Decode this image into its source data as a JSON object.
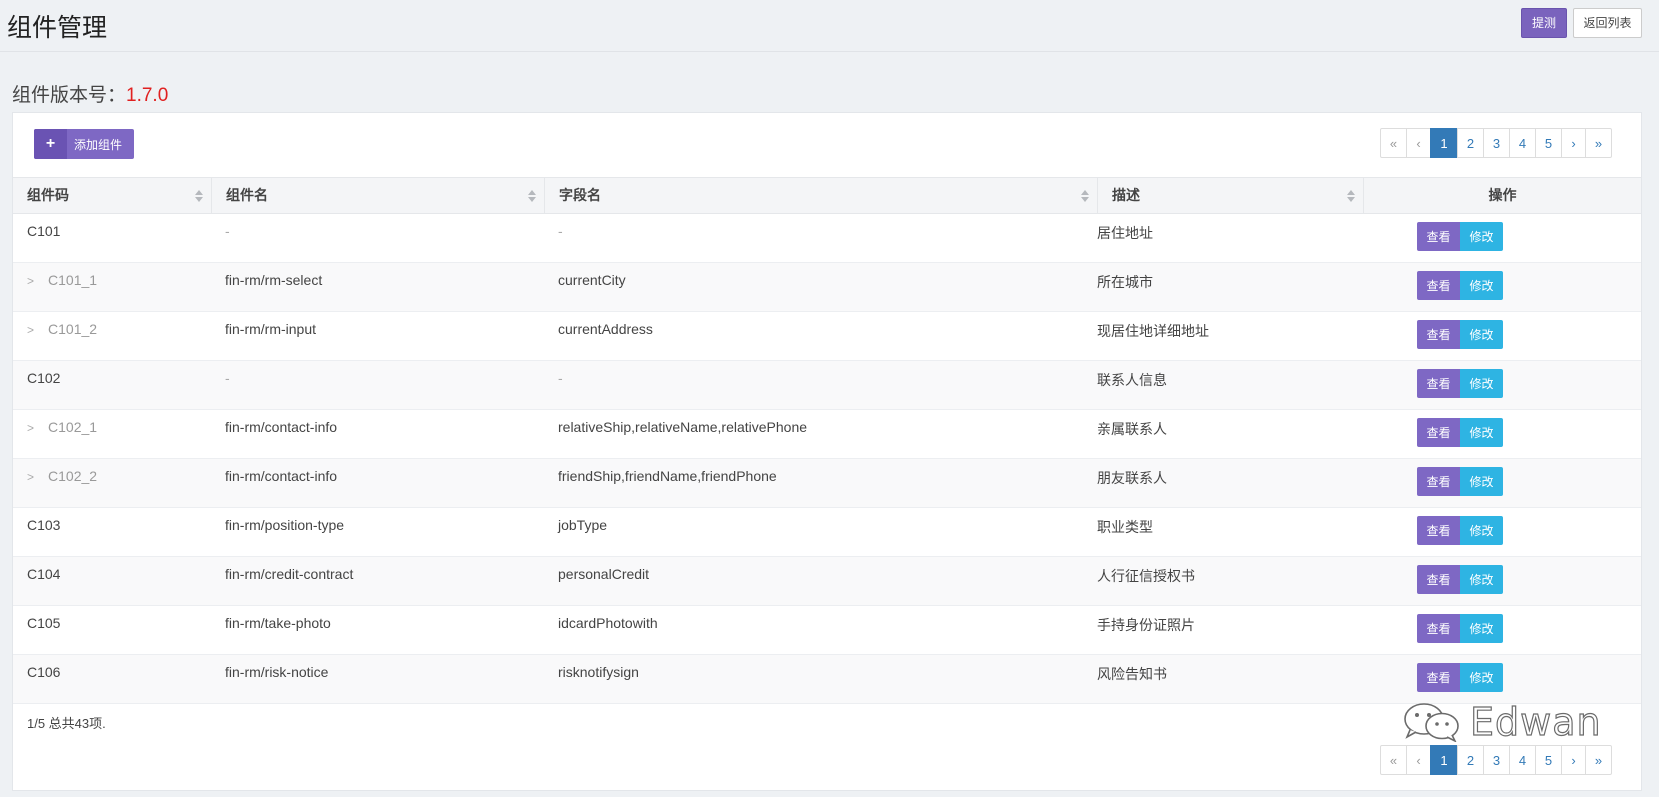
{
  "header": {
    "title": "组件管理",
    "submit_label": "提测",
    "back_label": "返回列表"
  },
  "version": {
    "label": "组件版本号：",
    "value": "1.7.0"
  },
  "toolbar": {
    "add_label": "添加组件",
    "add_icon": "plus-icon"
  },
  "pagination": {
    "first": "«",
    "prev": "‹",
    "pages": [
      "1",
      "2",
      "3",
      "4",
      "5"
    ],
    "current": "1",
    "next": "›",
    "last": "»"
  },
  "table": {
    "columns": [
      "组件码",
      "组件名",
      "字段名",
      "描述",
      "操作"
    ],
    "view_label": "查看",
    "edit_label": "修改",
    "rows": [
      {
        "code": "C101",
        "child": false,
        "name": "-",
        "field": "-",
        "desc": "居住地址"
      },
      {
        "code": "C101_1",
        "child": true,
        "name": "fin-rm/rm-select",
        "field": "currentCity",
        "desc": "所在城市"
      },
      {
        "code": "C101_2",
        "child": true,
        "name": "fin-rm/rm-input",
        "field": "currentAddress",
        "desc": "现居住地详细地址"
      },
      {
        "code": "C102",
        "child": false,
        "name": "-",
        "field": "-",
        "desc": "联系人信息"
      },
      {
        "code": "C102_1",
        "child": true,
        "name": "fin-rm/contact-info",
        "field": "relativeShip,relativeName,relativePhone",
        "desc": "亲属联系人"
      },
      {
        "code": "C102_2",
        "child": true,
        "name": "fin-rm/contact-info",
        "field": "friendShip,friendName,friendPhone",
        "desc": "朋友联系人"
      },
      {
        "code": "C103",
        "child": false,
        "name": "fin-rm/position-type",
        "field": "jobType",
        "desc": "职业类型"
      },
      {
        "code": "C104",
        "child": false,
        "name": "fin-rm/credit-contract",
        "field": "personalCredit",
        "desc": "人行征信授权书"
      },
      {
        "code": "C105",
        "child": false,
        "name": "fin-rm/take-photo",
        "field": "idcardPhotowith",
        "desc": "手持身份证照片"
      },
      {
        "code": "C106",
        "child": false,
        "name": "fin-rm/risk-notice",
        "field": "risknotifysign",
        "desc": "风险告知书"
      }
    ]
  },
  "footer": {
    "summary": "1/5 总共43项."
  },
  "watermark": {
    "text": "Edwan",
    "icon": "wechat-icon"
  }
}
